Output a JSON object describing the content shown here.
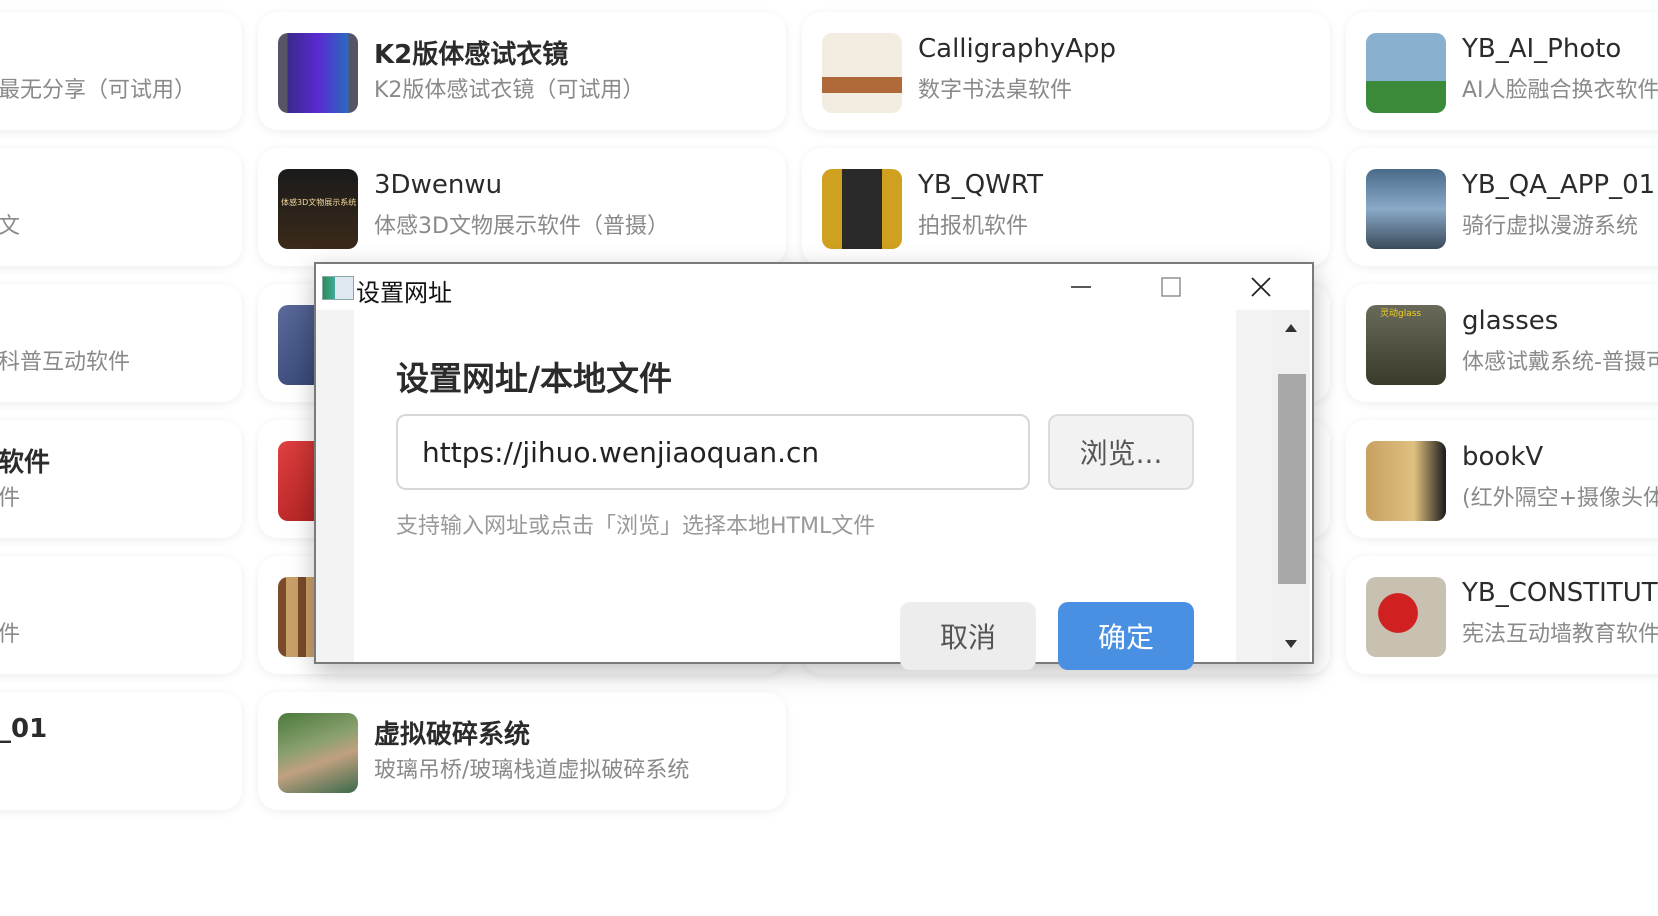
{
  "grid": {
    "col0": [
      {
        "title": "",
        "subtitle": "最无分享（可试用）"
      },
      {
        "title": "",
        "subtitle": "文"
      },
      {
        "title": "",
        "subtitle": "科普互动软件"
      },
      {
        "title": "软件",
        "subtitle": "件"
      },
      {
        "title": "",
        "subtitle": "件"
      },
      {
        "title": "_01",
        "subtitle": ""
      }
    ],
    "col1": [
      {
        "title": "K2版体感试衣镜",
        "subtitle": "K2版体感试衣镜（可试用）"
      },
      {
        "title": "3Dwenwu",
        "subtitle": "体感3D文物展示软件（普摄）"
      },
      {
        "title": "",
        "subtitle": ""
      },
      {
        "title": "",
        "subtitle": ""
      },
      {
        "title": "",
        "subtitle": ""
      },
      {
        "title": "虚拟破碎系统",
        "subtitle": "玻璃吊桥/玻璃栈道虚拟破碎系统"
      }
    ],
    "col2": [
      {
        "title": "CalligraphyApp",
        "subtitle": "数字书法桌软件"
      },
      {
        "title": "YB_QWRT",
        "subtitle": "拍报机软件"
      }
    ],
    "col3": [
      {
        "title": "YB_AI_Photo",
        "subtitle": "AI人脸融合换衣软件"
      },
      {
        "title": "YB_QA_APP_01",
        "subtitle": "骑行虚拟漫游系统"
      },
      {
        "title": "glasses",
        "subtitle": "体感试戴系统-普摄可"
      },
      {
        "title": "bookV",
        "subtitle": "(红外隔空+摄像头体"
      },
      {
        "title": "YB_CONSTITUTIO",
        "subtitle": "宪法互动墙教育软件"
      }
    ]
  },
  "thumb_text": {
    "wenwu": "体感3D文物展示系统",
    "glasses": "灵动glass"
  },
  "dialog": {
    "window_title": "设置网址",
    "heading": "设置网址/本地文件",
    "url_value": "https://jihuo.wenjiaoquan.cn",
    "browse_label": "浏览...",
    "hint": "支持输入网址或点击「浏览」选择本地HTML文件",
    "cancel_label": "取消",
    "ok_label": "确定",
    "minimize_icon": "minimize-icon",
    "maximize_icon": "maximize-icon",
    "close_icon": "close-icon"
  },
  "colors": {
    "primary": "#4a90e2",
    "muted_text": "#8a8a8a"
  }
}
